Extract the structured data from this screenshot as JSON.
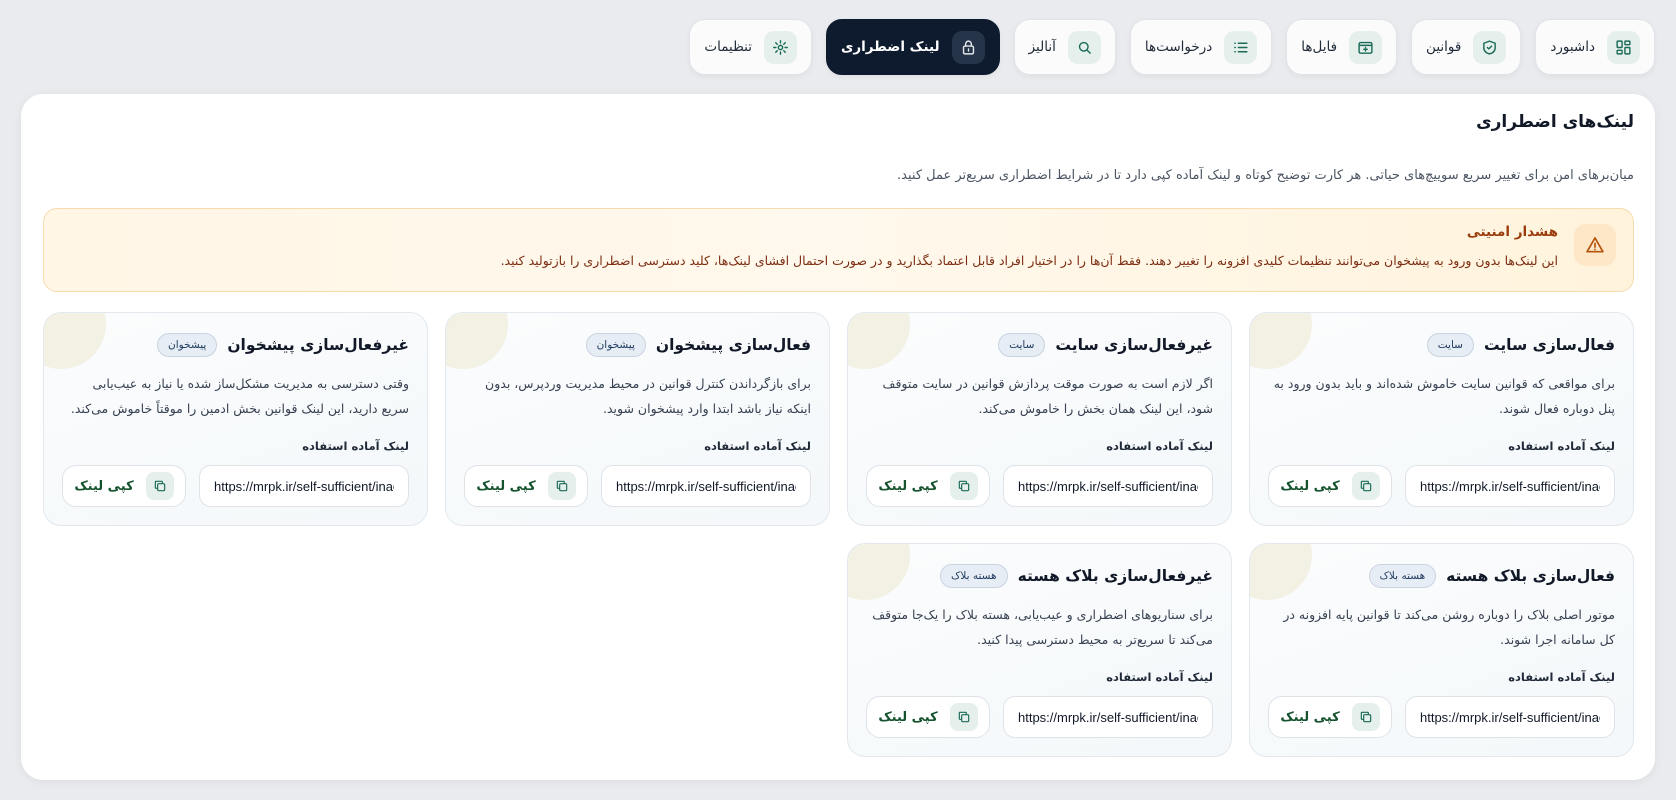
{
  "nav": {
    "tabs": [
      {
        "label": "داشبورد",
        "icon": "dashboard-icon",
        "active": false
      },
      {
        "label": "قوانین",
        "icon": "shield-check-icon",
        "active": false
      },
      {
        "label": "فایل‌ها",
        "icon": "file-plus-icon",
        "active": false
      },
      {
        "label": "درخواست‌ها",
        "icon": "list-icon",
        "active": false
      },
      {
        "label": "آنالیز",
        "icon": "search-icon",
        "active": false
      },
      {
        "label": "لینک اضطراری",
        "icon": "lock-icon",
        "active": true
      },
      {
        "label": "تنظیمات",
        "icon": "gear-icon",
        "active": false
      }
    ]
  },
  "page": {
    "title": "لینک‌های اضطراری",
    "description": "میان‌برهای امن برای تغییر سریع سوییچ‌های حیاتی. هر کارت توضیح کوتاه و لینک آماده کپی دارد تا در شرایط اضطراری سریع‌تر عمل کنید."
  },
  "warning": {
    "icon": "warning-triangle-icon",
    "title": "هشدار امنیتی",
    "text": "این لینک‌ها بدون ورود به پیشخوان می‌توانند تنظیمات کلیدی افزونه را تغییر دهند. فقط آن‌ها را در اختیار افراد قابل اعتماد بگذارید و در صورت احتمال افشای لینک‌ها، کلید دسترسی اضطراری را بازتولید کنید."
  },
  "cards": {
    "ready_label": "لینک آماده استفاده",
    "copy_label": "کپی لینک",
    "copy_icon": "copy-icon",
    "items": [
      {
        "title": "فعال‌سازی سایت",
        "badge": "سایت",
        "description": "برای مواقعی که قوانین سایت خاموش شده‌اند و باید بدون ورود به پنل دوباره فعال شوند.",
        "url": "https://mrpk.ir/self-sufficient/inactive"
      },
      {
        "title": "غیرفعال‌سازی سایت",
        "badge": "سایت",
        "description": "اگر لازم است به صورت موقت پردازش قوانین در سایت متوقف شود، این لینک همان بخش را خاموش می‌کند.",
        "url": "https://mrpk.ir/self-sufficient/inactive"
      },
      {
        "title": "فعال‌سازی پیشخوان",
        "badge": "پیشخوان",
        "description": "برای بازگرداندن کنترل قوانین در محیط مدیریت وردپرس، بدون اینکه نیاز باشد ابتدا وارد پیشخوان شوید.",
        "url": "https://mrpk.ir/self-sufficient/inactive"
      },
      {
        "title": "غیرفعال‌سازی پیشخوان",
        "badge": "پیشخوان",
        "description": "وقتی دسترسی به مدیریت مشکل‌ساز شده یا نیاز به عیب‌یابی سریع دارید، این لینک قوانین بخش ادمین را موقتاً خاموش می‌کند.",
        "url": "https://mrpk.ir/self-sufficient/inactive"
      },
      {
        "title": "فعال‌سازی بلاک هسته",
        "badge": "هسته بلاک",
        "description": "موتور اصلی بلاک را دوباره روشن می‌کند تا قوانین پایه افزونه در کل سامانه اجرا شوند.",
        "url": "https://mrpk.ir/self-sufficient/inactive"
      },
      {
        "title": "غیرفعال‌سازی بلاک هسته",
        "badge": "هسته بلاک",
        "description": "برای سناریوهای اضطراری و عیب‌یابی، هسته بلاک را یک‌جا متوقف می‌کند تا سریع‌تر به محیط دسترسی پیدا کنید.",
        "url": "https://mrpk.ir/self-sufficient/inactive"
      }
    ]
  }
}
